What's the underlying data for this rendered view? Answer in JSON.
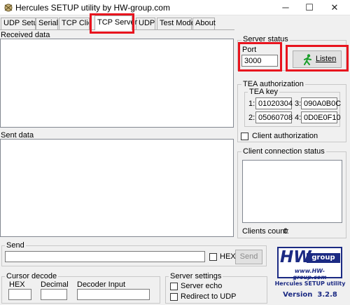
{
  "window": {
    "title": "Hercules SETUP utility by HW-group.com",
    "minimize_glyph": "─",
    "maximize_glyph": "☐",
    "close_glyph": "✕"
  },
  "tabs": [
    {
      "label": "UDP Setup"
    },
    {
      "label": "Serial"
    },
    {
      "label": "TCP Client"
    },
    {
      "label": "TCP Server"
    },
    {
      "label": "UDP"
    },
    {
      "label": "Test Mode"
    },
    {
      "label": "About"
    }
  ],
  "received": {
    "label": "Received data"
  },
  "sent": {
    "label": "Sent data"
  },
  "server_status": {
    "title": "Server status",
    "port_label": "Port",
    "port_value": "3000",
    "listen_label": "Listen"
  },
  "tea": {
    "title": "TEA authorization",
    "key_title": "TEA key",
    "keys": [
      {
        "index": "1:",
        "value": "01020304"
      },
      {
        "index": "3:",
        "value": "090A0B0C"
      },
      {
        "index": "2:",
        "value": "05060708"
      },
      {
        "index": "4:",
        "value": "0D0E0F10"
      }
    ],
    "client_auth_label": "Client authorization"
  },
  "client_status": {
    "title": "Client connection status",
    "count_label": "Clients count:",
    "count_value": "0"
  },
  "send": {
    "title": "Send",
    "hex_label": "HEX",
    "button_label": "Send"
  },
  "cursor_decode": {
    "title": "Cursor decode",
    "hex_label": "HEX",
    "decimal_label": "Decimal",
    "decoder_label": "Decoder Input"
  },
  "server_settings": {
    "title": "Server settings",
    "echo_label": "Server echo",
    "redirect_label": "Redirect to UDP"
  },
  "logo": {
    "hw": "HW",
    "group": "group",
    "url": "www.HW-group.com",
    "product": "Hercules SETUP utility",
    "version": "Version  3.2.8"
  },
  "colors": {
    "highlight": "#e8141e",
    "brand_blue": "#1b2a83",
    "listen_icon": "#1a9e2a"
  }
}
